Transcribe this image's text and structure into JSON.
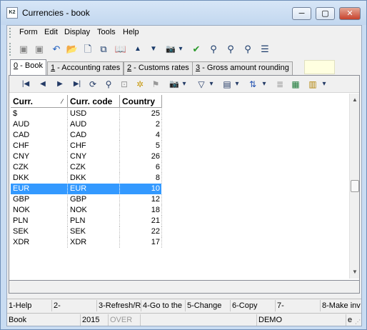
{
  "window": {
    "title": "Currencies - book",
    "app_icon_text": "K2",
    "minimize": "─",
    "maximize": "▢",
    "close": "✕"
  },
  "menu": [
    "Form",
    "Edit",
    "Display",
    "Tools",
    "Help"
  ],
  "toolbar1": [
    {
      "name": "save-icon",
      "glyph": "▣"
    },
    {
      "name": "save-all-icon",
      "glyph": "▣"
    },
    {
      "name": "undo-icon",
      "glyph": "↶"
    },
    {
      "name": "open-folder-icon",
      "glyph": "📂"
    },
    {
      "name": "new-document-icon",
      "glyph": "🗋"
    },
    {
      "name": "copy-document-icon",
      "glyph": "⧉"
    },
    {
      "name": "book-icon",
      "glyph": "📖"
    },
    {
      "name": "arrow-up-icon",
      "glyph": "▲"
    },
    {
      "name": "arrow-down-icon",
      "glyph": "▼"
    },
    {
      "name": "camera-icon",
      "glyph": "📷"
    },
    {
      "name": "dropdown-icon",
      "glyph": "▾"
    },
    {
      "name": "filter-green-icon",
      "glyph": "✔"
    },
    {
      "name": "binoculars-icon",
      "glyph": "⚲"
    },
    {
      "name": "binoculars-next-icon",
      "glyph": "⚲"
    },
    {
      "name": "binoculars-plus-icon",
      "glyph": "⚲"
    },
    {
      "name": "menu-lines-icon",
      "glyph": "☰"
    }
  ],
  "tabs": [
    {
      "key": "0",
      "label": " - Book"
    },
    {
      "key": "1",
      "label": " - Accounting rates"
    },
    {
      "key": "2",
      "label": " - Customs rates"
    },
    {
      "key": "3",
      "label": " - Gross amount rounding"
    }
  ],
  "toolbar2": [
    {
      "name": "first-record-icon",
      "glyph": "|◀"
    },
    {
      "name": "previous-record-icon",
      "glyph": "◀"
    },
    {
      "name": "next-record-icon",
      "glyph": "▶"
    },
    {
      "name": "last-record-icon",
      "glyph": "▶|"
    },
    {
      "name": "refresh-icon",
      "glyph": "⟳"
    },
    {
      "name": "search-icon",
      "glyph": "⚲"
    },
    {
      "name": "lock-icon",
      "glyph": "⊡"
    },
    {
      "name": "add-star-icon",
      "glyph": "✲"
    },
    {
      "name": "tag-icon",
      "glyph": "⚑"
    },
    {
      "name": "camera-icon",
      "glyph": "📷"
    },
    {
      "name": "dropdown-icon",
      "glyph": "▾"
    },
    {
      "name": "filter-icon",
      "glyph": "▽"
    },
    {
      "name": "dropdown-icon",
      "glyph": "▾"
    },
    {
      "name": "columns-icon",
      "glyph": "▤"
    },
    {
      "name": "dropdown-icon",
      "glyph": "▾"
    },
    {
      "name": "sort-az-icon",
      "glyph": "⇅"
    },
    {
      "name": "dropdown-icon",
      "glyph": "▾"
    },
    {
      "name": "list-icon",
      "glyph": "≣"
    },
    {
      "name": "excel-icon",
      "glyph": "▦"
    },
    {
      "name": "report-icon",
      "glyph": "▥"
    },
    {
      "name": "dropdown-icon",
      "glyph": "▾"
    }
  ],
  "grid": {
    "headers": [
      "Curr.",
      "Curr. code",
      "Country"
    ],
    "sort_mark": "⁄",
    "rows": [
      [
        "$",
        "USD",
        "25"
      ],
      [
        "AUD",
        "AUD",
        "2"
      ],
      [
        "CAD",
        "CAD",
        "4"
      ],
      [
        "CHF",
        "CHF",
        "5"
      ],
      [
        "CNY",
        "CNY",
        "26"
      ],
      [
        "CZK",
        "CZK",
        "6"
      ],
      [
        "DKK",
        "DKK",
        "8"
      ],
      [
        "EUR",
        "EUR",
        "10"
      ],
      [
        "GBP",
        "GBP",
        "12"
      ],
      [
        "NOK",
        "NOK",
        "18"
      ],
      [
        "PLN",
        "PLN",
        "21"
      ],
      [
        "SEK",
        "SEK",
        "22"
      ],
      [
        "XDR",
        "XDR",
        "17"
      ]
    ],
    "selected_row": 7
  },
  "scrollbar": {
    "up": "▲",
    "down": "▼"
  },
  "fkeys": [
    "1-Help",
    "2-",
    "3-Refresh/R",
    "4-Go to the",
    "5-Change",
    "6-Copy",
    "7-",
    "8-Make inv"
  ],
  "status": [
    "Book",
    "",
    "2015",
    "OVER",
    "",
    "DEMO",
    "e",
    ""
  ]
}
